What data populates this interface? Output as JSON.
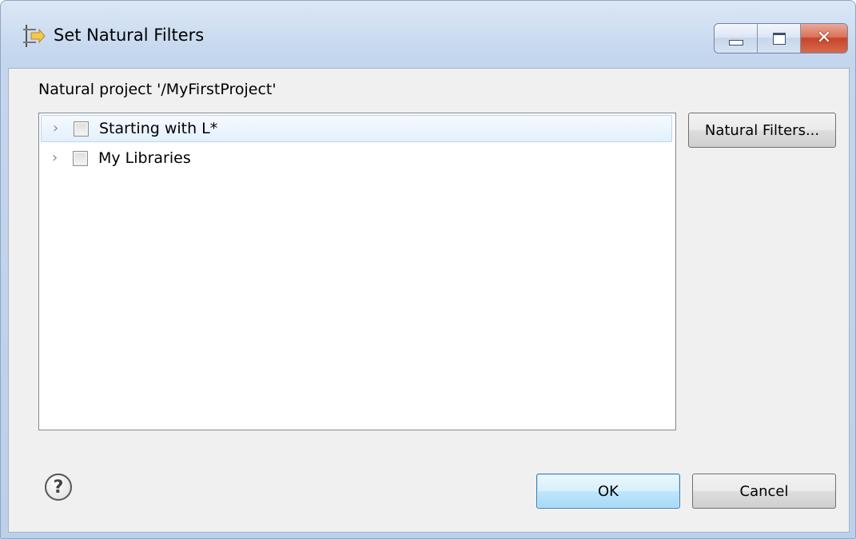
{
  "window": {
    "title": "Set Natural Filters",
    "close_glyph": "✕"
  },
  "dialog": {
    "project_label": "Natural project '/MyFirstProject'",
    "tree_items": [
      {
        "label": "Starting with L*",
        "checked": false,
        "selected": true,
        "expander": "›"
      },
      {
        "label": "My Libraries",
        "checked": false,
        "selected": false,
        "expander": "›"
      }
    ],
    "natural_filters_button": "Natural Filters...",
    "ok_button": "OK",
    "cancel_button": "Cancel",
    "help_glyph": "?"
  },
  "icons": {
    "app": "filter-arrows-icon",
    "help": "help-icon",
    "minimize": "minimize-icon",
    "maximize": "maximize-icon",
    "close": "close-icon"
  },
  "colors": {
    "title_bar": "#c4d6ee",
    "client_bg": "#f0f0f0",
    "selection": "#e3f0fc",
    "default_button": "#bee6fd",
    "close_button": "#c8452a"
  }
}
